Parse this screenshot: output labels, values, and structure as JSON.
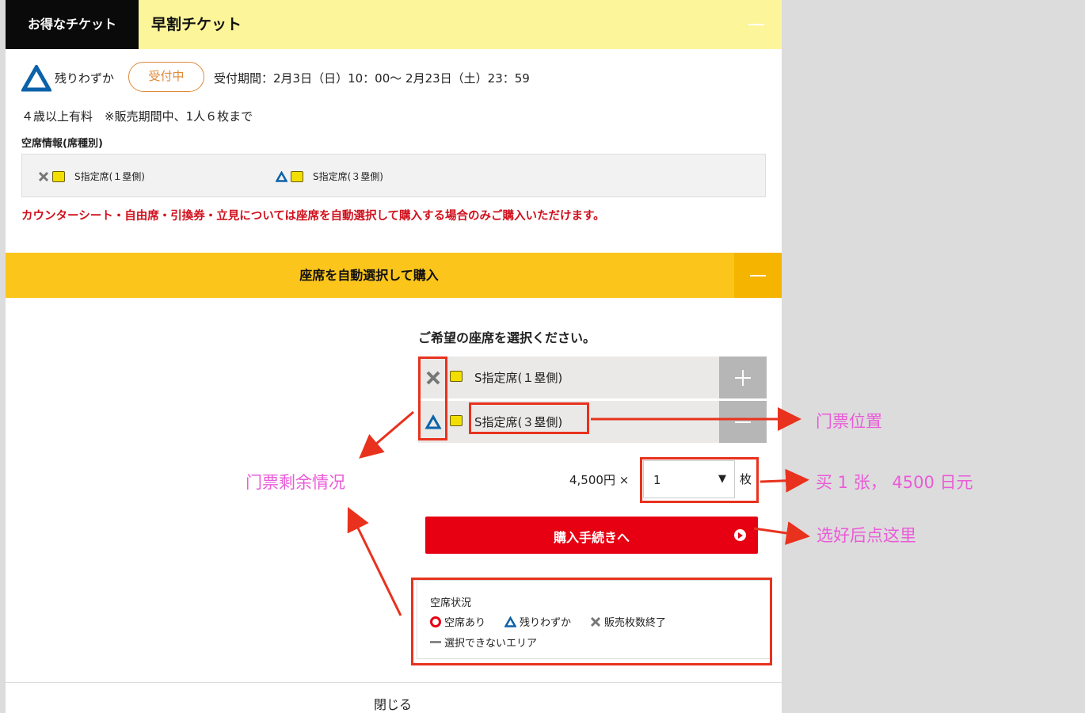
{
  "header": {
    "tab_label": "お得なチケット",
    "ticket_name": "早割チケット"
  },
  "status": {
    "availability": "残りわずか",
    "badge": "受付中",
    "period": "受付期間：2月3日（日）10：00〜 2月23日（土）23：59",
    "notes": "４歳以上有料　※販売期間中、1人６枚まで"
  },
  "seat_info": {
    "title": "空席情報(席種別)",
    "items": [
      {
        "status_icon": "cross-icon",
        "label": "S指定席(１塁側)"
      },
      {
        "status_icon": "triangle-icon",
        "label": "S指定席(３塁側)"
      }
    ]
  },
  "warning": "カウンターシート・自由席・引換券・立見については座席を自動選択して購入する場合のみご購入いただけます。",
  "auto_select": {
    "title": "座席を自動選択して購入",
    "prompt": "ご希望の座席を選択ください。",
    "seats": [
      {
        "status_icon": "cross-icon",
        "label": "S指定席(１塁側)",
        "toggle": "plus"
      },
      {
        "status_icon": "triangle-icon",
        "label": "S指定席(３塁側)",
        "toggle": "minus"
      }
    ],
    "price": "4,500円 ×",
    "quantity": "1",
    "unit": "枚",
    "buy_button": "購入手続きへ"
  },
  "legend": {
    "title": "空席状況",
    "available": "空席あり",
    "few_left": "残りわずか",
    "sold_out": "販売枚数終了",
    "unavailable": "選択できないエリア"
  },
  "close_label": "閉じる",
  "annotations": {
    "ticket_position": "门票位置",
    "remaining": "门票剩余情况",
    "quantity_note": "买 1 张， 4500 日元",
    "click_here": "选好后点这里"
  },
  "colors": {
    "top_bar": "#fdf59a",
    "section_bar": "#fbc51c",
    "buy_button": "#e60012",
    "annotation_box": "#e8321e",
    "annotation_text": "#ea5bd8"
  }
}
